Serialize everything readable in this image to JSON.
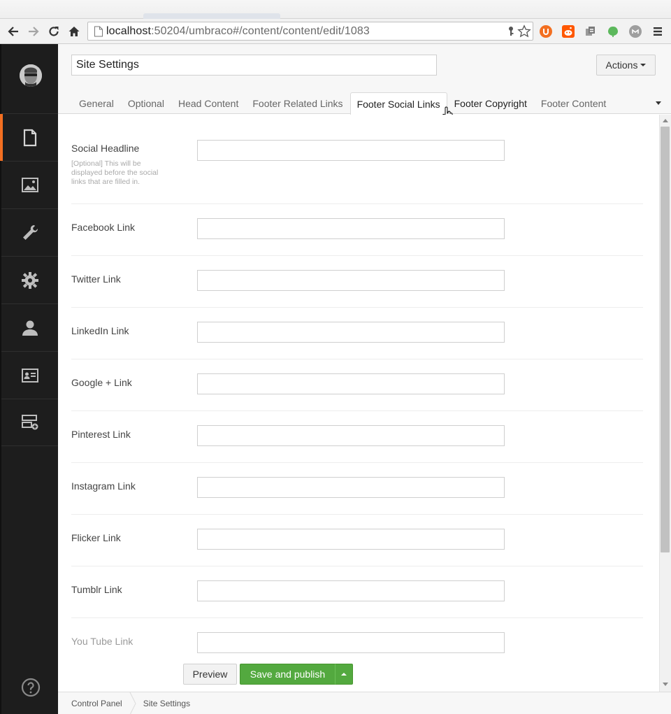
{
  "browser": {
    "url_host": "localhost",
    "url_rest": ":50204/umbraco#/content/content/edit/1083",
    "icons": [
      "back-icon",
      "forward-icon",
      "reload-icon",
      "home-icon",
      "page-icon",
      "key-icon",
      "star-icon",
      "menu-icon"
    ],
    "extension_colors": [
      "#f36f21",
      "#ff5700",
      "#8a8a8a",
      "#5cb85c",
      "#9e9e9e"
    ]
  },
  "sidebar": {
    "sections": [
      {
        "name": "content",
        "icon": "document-icon",
        "active": true
      },
      {
        "name": "media",
        "icon": "image-icon",
        "active": false
      },
      {
        "name": "developer",
        "icon": "wrench-icon",
        "active": false
      },
      {
        "name": "settings",
        "icon": "gear-icon",
        "active": false
      },
      {
        "name": "users",
        "icon": "user-icon",
        "active": false
      },
      {
        "name": "members",
        "icon": "id-card-icon",
        "active": false
      },
      {
        "name": "forms",
        "icon": "forms-icon",
        "active": false
      }
    ],
    "accent_color": "#f36f21"
  },
  "header": {
    "name_value": "Site Settings",
    "actions_label": "Actions",
    "tabs": [
      {
        "label": "General"
      },
      {
        "label": "Optional"
      },
      {
        "label": "Head Content"
      },
      {
        "label": "Footer Related Links"
      },
      {
        "label": "Footer Social Links"
      },
      {
        "label": "Footer Copyright"
      },
      {
        "label": "Footer Content"
      }
    ],
    "active_tab": "Footer Social Links"
  },
  "fields": [
    {
      "label": "Social Headline",
      "description": "[Optional] This will be displayed before the social links that are filled in.",
      "value": ""
    },
    {
      "label": "Facebook Link",
      "value": ""
    },
    {
      "label": "Twitter Link",
      "value": ""
    },
    {
      "label": "LinkedIn Link",
      "value": ""
    },
    {
      "label": "Google + Link",
      "value": ""
    },
    {
      "label": "Pinterest Link",
      "value": ""
    },
    {
      "label": "Instagram Link",
      "value": ""
    },
    {
      "label": "Flicker Link",
      "value": ""
    },
    {
      "label": "Tumblr Link",
      "value": ""
    },
    {
      "label": "You Tube Link",
      "value": ""
    }
  ],
  "footer": {
    "preview_label": "Preview",
    "publish_label": "Save and publish",
    "publish_color": "#53a93f"
  },
  "breadcrumb": [
    "Control Panel",
    "Site Settings"
  ]
}
